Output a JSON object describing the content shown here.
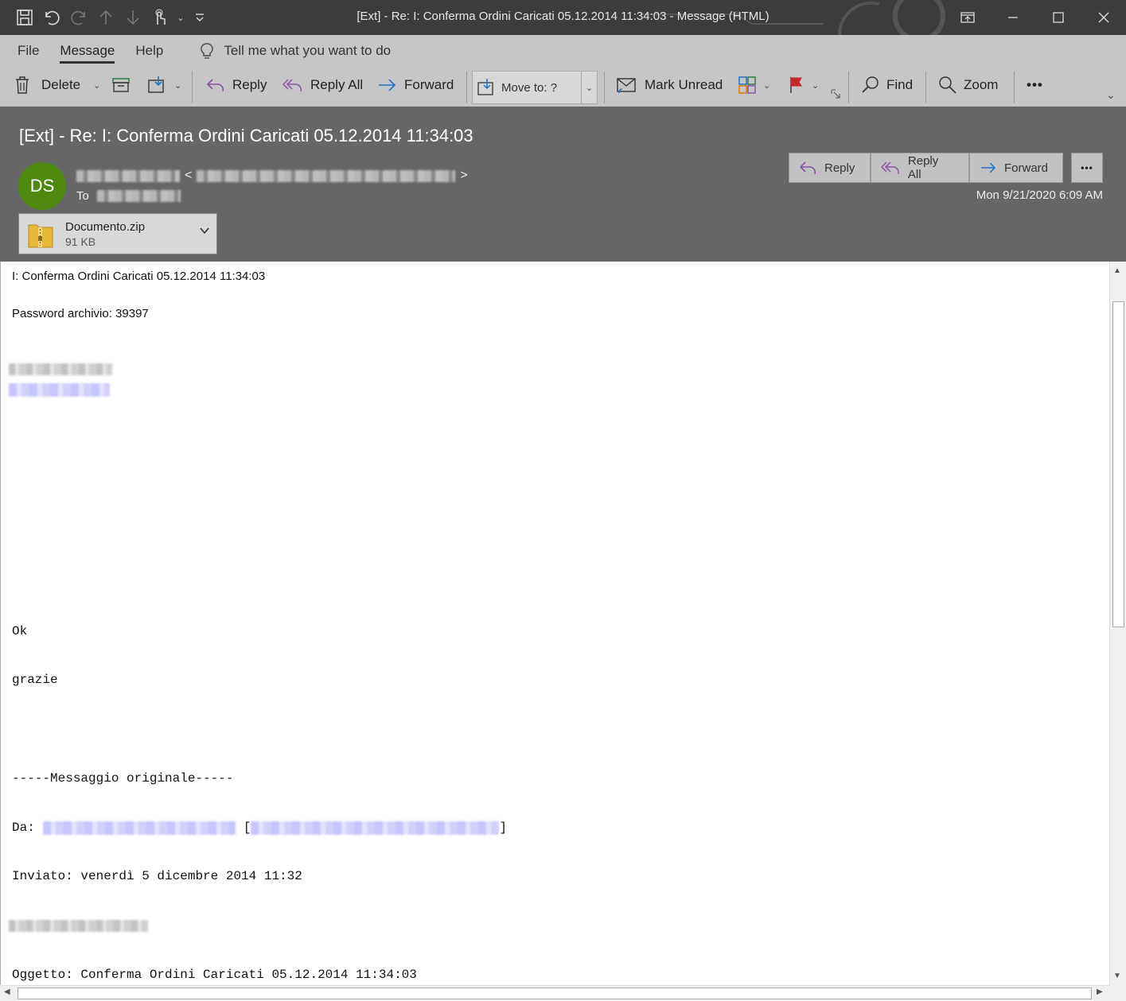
{
  "window": {
    "title": "[Ext] - Re: I: Conferma Ordini Caricati 05.12.2014 11:34:03  -  Message (HTML)"
  },
  "ribbon": {
    "tabs": [
      {
        "label": "File"
      },
      {
        "label": "Message"
      },
      {
        "label": "Help"
      }
    ],
    "tell_me": "Tell me what you want to do",
    "commands": {
      "delete": "Delete",
      "reply": "Reply",
      "reply_all": "Reply All",
      "forward": "Forward",
      "move_to": "Move to: ?",
      "mark_unread": "Mark Unread",
      "find": "Find",
      "zoom": "Zoom",
      "more": "•••"
    }
  },
  "header": {
    "subject": "[Ext] - Re: I: Conferma Ordini Caricati 05.12.2014 11:34:03",
    "avatar_initials": "DS",
    "avatar_color": "#4f8a10",
    "to_label": "To",
    "date": "Mon 9/21/2020 6:09 AM",
    "actions": {
      "reply": "Reply",
      "reply_all": "Reply All",
      "forward": "Forward",
      "more": "•••"
    },
    "attachment": {
      "name": "Documento.zip",
      "size": "91 KB"
    }
  },
  "body": {
    "line1": "I: Conferma Ordini Caricati 05.12.2014 11:34:03",
    "line2": "Password archivio: 39397",
    "ok": "Ok",
    "grazie": "grazie",
    "original": "-----Messaggio originale-----",
    "da_label": "Da:",
    "inviato": "Inviato: venerdì 5 dicembre 2014 11:32",
    "oggetto": "Oggetto: Conferma Ordini Caricati 05.12.2014 11:34:03"
  }
}
